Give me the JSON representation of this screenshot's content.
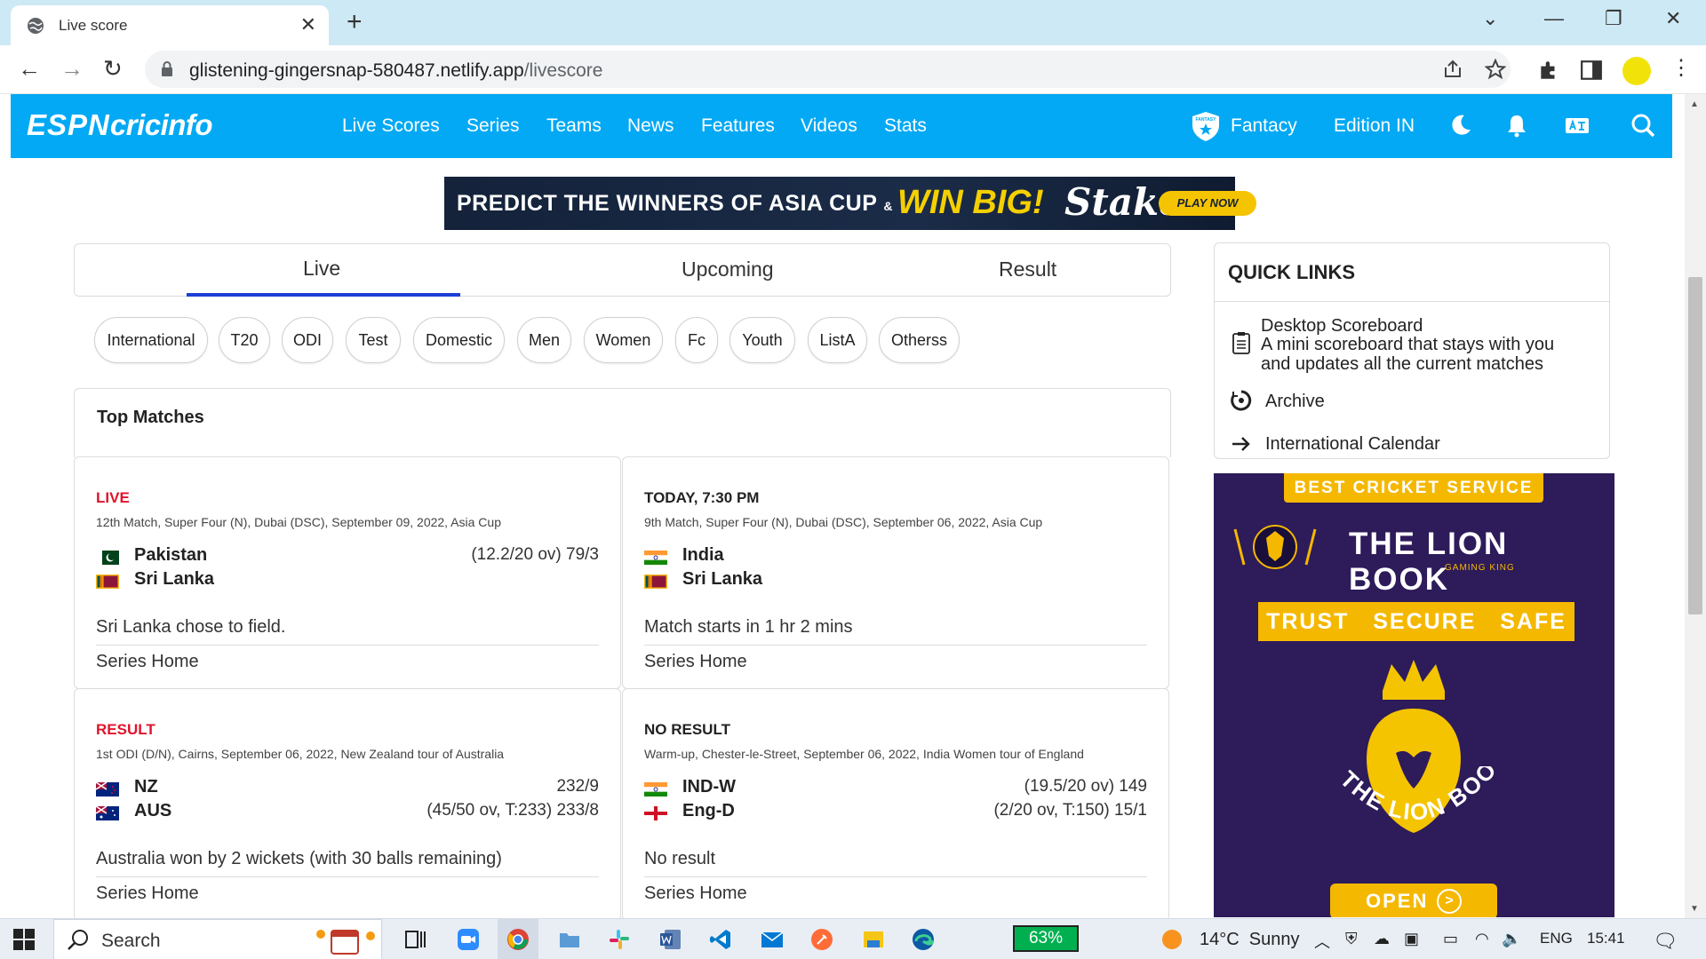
{
  "browser": {
    "tab_title": "Live score",
    "new_tab": "+",
    "url_host": "glistening-gingersnap-580487.netlify.app",
    "url_path": "/livescore"
  },
  "site": {
    "logo_espn": "ESPN",
    "logo_cricinfo": "cricinfo",
    "nav": [
      "Live Scores",
      "Series",
      "Teams",
      "News",
      "Features",
      "Videos",
      "Stats"
    ],
    "fantasy": "Fantacy",
    "fantasy_badge": "FANTASY",
    "edition": "Edition IN",
    "color_primary": "#03a9f4"
  },
  "banner": {
    "text": "PREDICT THE WINNERS OF ASIA CUP",
    "amp": "&",
    "win": "WIN BIG!",
    "brand": "Stake",
    "cta": "PLAY NOW"
  },
  "tabs": [
    "Live",
    "Upcoming",
    "Result"
  ],
  "filters": [
    "International",
    "T20",
    "ODI",
    "Test",
    "Domestic",
    "Men",
    "Women",
    "Fc",
    "Youth",
    "ListA",
    "Otherss"
  ],
  "top_matches": {
    "title": "Top Matches",
    "matches": [
      {
        "status": "LIVE",
        "meta": "12th Match, Super Four (N), Dubai (DSC), September 09, 2022, Asia Cup",
        "teams": [
          {
            "name": "Pakistan",
            "score": "(12.2/20 ov) 79/3"
          },
          {
            "name": "Sri Lanka",
            "score": ""
          }
        ],
        "summary": "Sri Lanka chose to field.",
        "link": "Series Home"
      },
      {
        "status": "TODAY, 7:30 PM",
        "meta": "9th Match, Super Four (N), Dubai (DSC), September 06, 2022, Asia Cup",
        "teams": [
          {
            "name": "India",
            "score": ""
          },
          {
            "name": "Sri Lanka",
            "score": ""
          }
        ],
        "summary": "Match starts in 1 hr 2 mins",
        "link": "Series Home"
      },
      {
        "status": "RESULT",
        "meta": "1st ODI (D/N), Cairns, September 06, 2022, New Zealand tour of Australia",
        "teams": [
          {
            "name": "NZ",
            "score": "232/9"
          },
          {
            "name": "AUS",
            "score": "(45/50 ov, T:233) 233/8"
          }
        ],
        "summary": "Australia won by 2 wickets (with 30 balls remaining)",
        "link": "Series Home"
      },
      {
        "status": "NO RESULT",
        "meta": "Warm-up, Chester-le-Street, September 06, 2022, India Women tour of England",
        "teams": [
          {
            "name": "IND-W",
            "score": "(19.5/20 ov) 149"
          },
          {
            "name": "Eng-D",
            "score": "(2/20 ov, T:150) 15/1"
          }
        ],
        "summary": "No result",
        "link": "Series Home"
      }
    ]
  },
  "quick_links": {
    "title": "QUICK LINKS",
    "items": [
      {
        "title": "Desktop Scoreboard",
        "desc1": "A mini scoreboard that stays with you",
        "desc2": "and updates all the current matches"
      },
      {
        "title": "Archive"
      },
      {
        "title": "International Calendar"
      }
    ]
  },
  "side_ad": {
    "top": "BEST CRICKET SERVICE",
    "brand": "THE LION BOOK",
    "sub": "GAMING KING",
    "tagline": "TRUST   SECURE   SAFE",
    "emblem_text": "THE LION BOOK",
    "cta": "OPEN"
  },
  "taskbar": {
    "search": "Search",
    "battery": "63%",
    "weather": "14°C  Sunny",
    "lang": "ENG",
    "time": "15:41"
  }
}
